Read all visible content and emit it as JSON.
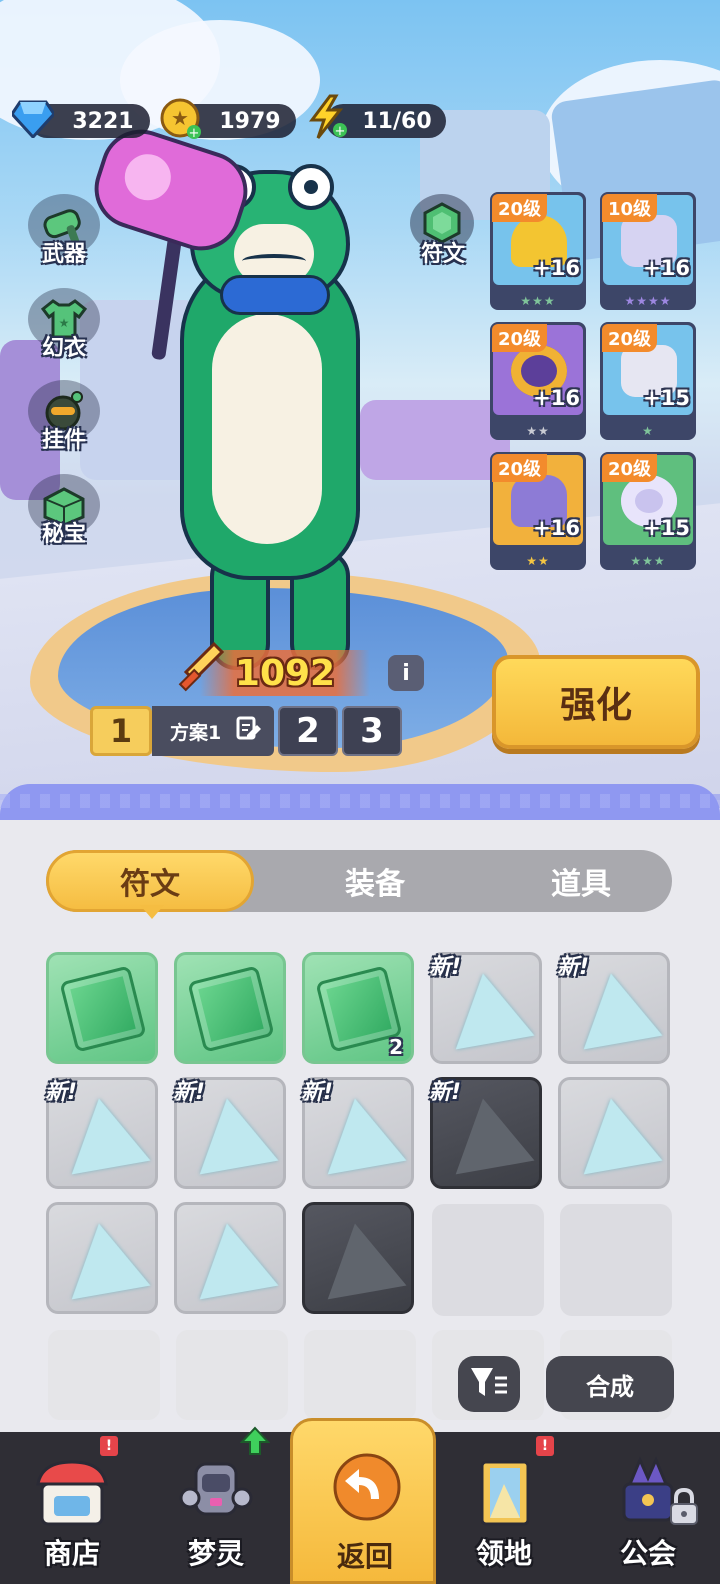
{
  "resources": {
    "gems": "3221",
    "coins": "1979",
    "energy": "11/60"
  },
  "side_menu": {
    "weapon": "武器",
    "outfit": "幻衣",
    "pendant": "挂件",
    "treasure": "秘宝",
    "rune": "符文"
  },
  "equipment": [
    {
      "level": "20级",
      "plus": "+16",
      "stars": "★★★",
      "star_color": "#7fc49a"
    },
    {
      "level": "10级",
      "plus": "+16",
      "stars": "★★★★",
      "star_color": "#9d87e0"
    },
    {
      "level": "20级",
      "plus": "+16",
      "stars": "★★",
      "star_color": "#c9cbd3"
    },
    {
      "level": "20级",
      "plus": "+15",
      "stars": "★",
      "star_color": "#7fc49a"
    },
    {
      "level": "20级",
      "plus": "+16",
      "stars": "★★",
      "star_color": "#f4c542"
    },
    {
      "level": "20级",
      "plus": "+15",
      "stars": "★★★",
      "star_color": "#7fc49a"
    }
  ],
  "power": "1092",
  "info_icon": "i",
  "plans": {
    "current": "1",
    "current_name": "方案1",
    "other1": "2",
    "other2": "3"
  },
  "strengthen_label": "强化",
  "tabs": {
    "rune": "符文",
    "equip": "装备",
    "item": "道具"
  },
  "inventory": {
    "new_badge": "新!",
    "stack_count": "2"
  },
  "buttons": {
    "merge": "合成"
  },
  "nav": {
    "shop": "商店",
    "spirit": "梦灵",
    "back": "返回",
    "territory": "领地",
    "guild": "公会",
    "alert": "!"
  }
}
